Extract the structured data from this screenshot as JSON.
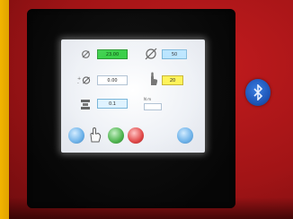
{
  "device": {
    "housing_color": "#a11416",
    "strip_color": "#f2b400",
    "bluetooth_icon": "bluetooth-icon"
  },
  "panel": {
    "row1": {
      "left_icon": "diameter-icon",
      "left_value": "23.00",
      "right_icon": "diameter-slash-icon",
      "right_value": "50"
    },
    "row2": {
      "left_icon": "plus-minus-diameter-icon",
      "left_value": "0.00",
      "right_icon": "hand-point-icon",
      "right_value": "20"
    },
    "row3": {
      "left_icon": "stack-icon",
      "left_value": "0.1",
      "right_small_label": "N m",
      "right_value": ""
    },
    "bottom_buttons": {
      "left_icon": "blue-circle-button",
      "hand_icon": "hand-icon",
      "green_icon": "green-circle-button",
      "red_icon": "red-circle-button",
      "right_icon": "blue-circle-button"
    }
  }
}
